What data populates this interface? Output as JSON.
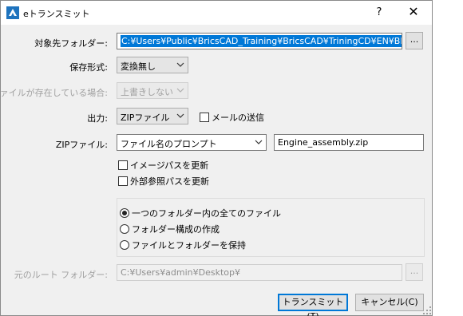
{
  "window": {
    "title": "eトランスミット",
    "help_label": "?",
    "close_label": "✕",
    "icon": "bricscad-logo-icon"
  },
  "form": {
    "target_folder": {
      "label": "対象先フォルダー:",
      "value": "C:¥Users¥Public¥BricsCAD_Training¥BricsCAD¥TriningCD¥EN¥BIM",
      "browse_label": "..."
    },
    "save_format": {
      "label": "保存形式:",
      "value": "変換無し"
    },
    "file_exists": {
      "label": "ファイルが存在している場合:",
      "value": "上書きしない",
      "disabled": true
    },
    "output": {
      "label": "出力:",
      "value": "ZIPファイル",
      "send_mail_label": "メールの送信",
      "send_mail_checked": false
    },
    "zip_file": {
      "label": "ZIPファイル:",
      "mode": "ファイル名のプロンプト",
      "filename": "Engine_assembly.zip"
    },
    "update_image_paths": {
      "label": "イメージパスを更新",
      "checked": false
    },
    "update_xref_paths": {
      "label": "外部参照パスを更新",
      "checked": false
    },
    "folder_structure": {
      "options": [
        {
          "label": "一つのフォルダー内の全てのファイル",
          "selected": true
        },
        {
          "label": "フォルダー構成の作成",
          "selected": false
        },
        {
          "label": "ファイルとフォルダーを保持",
          "selected": false
        }
      ]
    },
    "source_root": {
      "label": "元のルート フォルダー:",
      "value": "C:¥Users¥admin¥Desktop¥",
      "browse_label": "...",
      "disabled": true
    }
  },
  "buttons": {
    "transmit_label": "トランスミット(T)",
    "cancel_label": "キャンセル(C)"
  },
  "colors": {
    "selection": "#0078d7",
    "dialog_bg": "#f0f0f0",
    "default_button_border": "#0078d7"
  }
}
